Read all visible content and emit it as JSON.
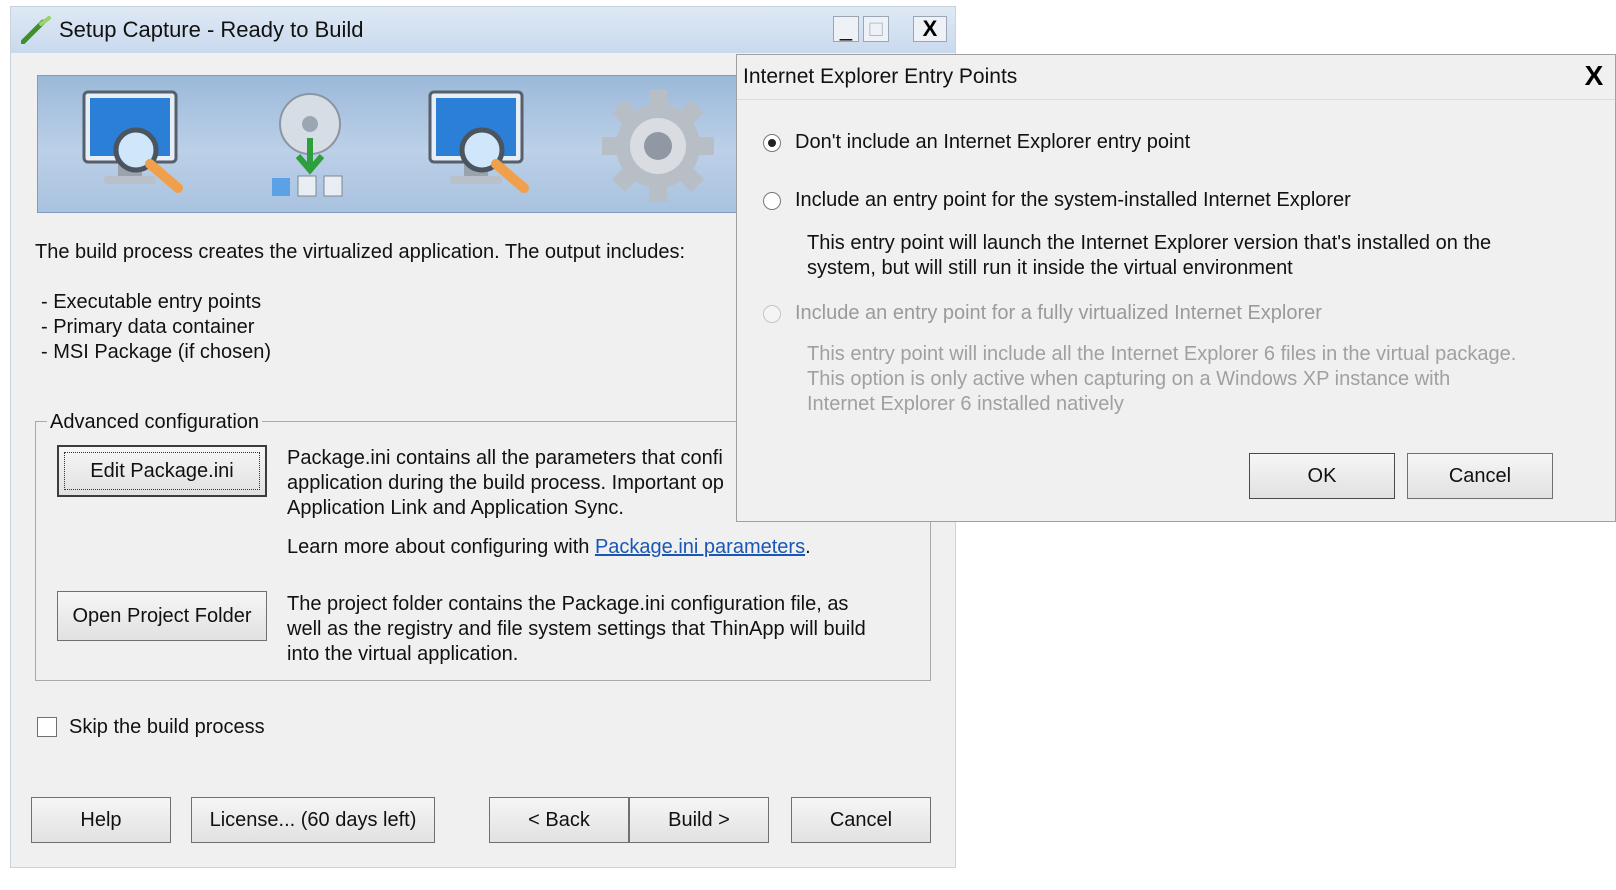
{
  "main_window": {
    "title": "Setup Capture - Ready to Build",
    "controls": {
      "minimize": "_",
      "maximize": "□",
      "close": "X"
    },
    "intro": "The build process creates the virtualized application. The output includes:",
    "outputs": [
      "- Executable entry points",
      "- Primary data container",
      "- MSI Package (if chosen)"
    ],
    "advanced": {
      "legend": "Advanced configuration",
      "edit_button": "Edit Package.ini",
      "edit_desc_lines": [
        "Package.ini contains all the parameters that confi",
        "application during the build process. Important op",
        "Application Link and Application Sync."
      ],
      "learn_more_prefix": "Learn more about configuring with ",
      "learn_more_link": "Package.ini parameters",
      "learn_more_suffix": ".",
      "open_button": "Open Project Folder",
      "open_desc_lines": [
        "The project folder contains the Package.ini configuration file, as",
        "well as the registry and file system settings that ThinApp will build",
        "into the virtual application."
      ]
    },
    "skip_checkbox": {
      "label": "Skip the build process",
      "checked": false
    },
    "footer": {
      "help": "Help",
      "license": "License... (60 days left)",
      "back": "< Back",
      "build": "Build >",
      "cancel": "Cancel"
    },
    "banner_icons": [
      "monitor-magnifier-icon",
      "disc-download-icon",
      "monitor-magnifier-icon",
      "gear-icon"
    ]
  },
  "dialog": {
    "title": "Internet Explorer Entry Points",
    "close": "X",
    "options": [
      {
        "label": "Don't include an Internet Explorer entry point",
        "checked": true,
        "disabled": false,
        "desc": []
      },
      {
        "label": "Include an entry point for the system-installed Internet Explorer",
        "checked": false,
        "disabled": false,
        "desc": [
          "This entry point will launch the Internet Explorer version that's installed on the",
          "system, but will still run it inside the virtual environment"
        ]
      },
      {
        "label": "Include an entry point for a fully virtualized Internet Explorer",
        "checked": false,
        "disabled": true,
        "desc": [
          "This entry point will include all the Internet Explorer 6 files in the virtual package.",
          "This option is only active when capturing on a Windows XP instance with",
          "Internet Explorer 6 installed natively"
        ]
      }
    ],
    "ok": "OK",
    "cancel": "Cancel"
  }
}
